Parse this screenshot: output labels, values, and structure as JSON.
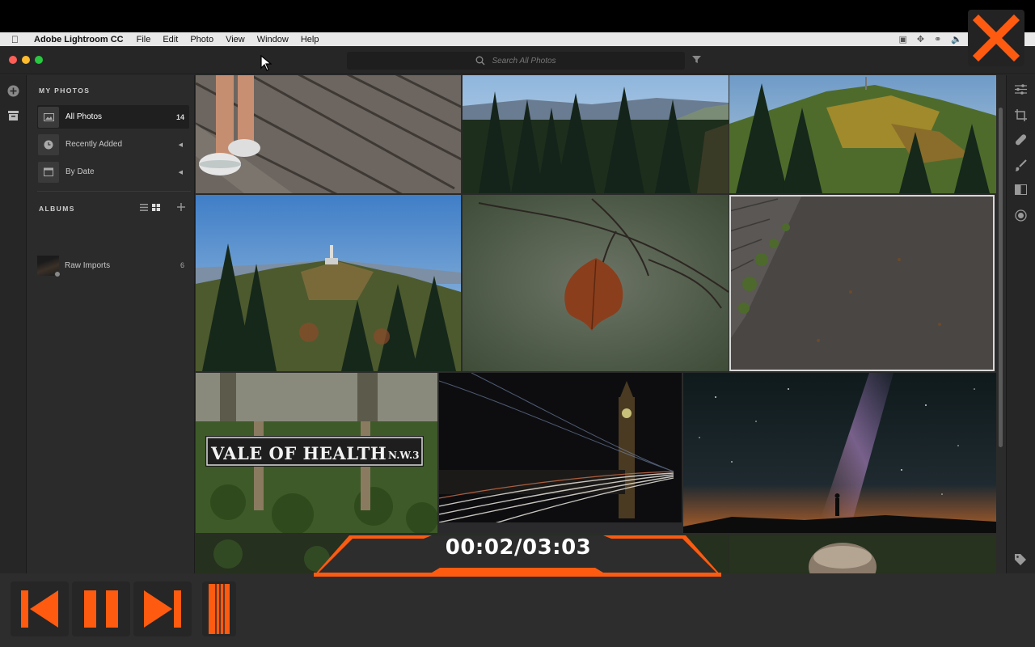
{
  "menubar": {
    "app_name": "Adobe Lightroom CC",
    "items": [
      "File",
      "Edit",
      "Photo",
      "View",
      "Window",
      "Help"
    ]
  },
  "search": {
    "placeholder": "Search All Photos"
  },
  "sidebar": {
    "my_photos_title": "MY PHOTOS",
    "nav": [
      {
        "label": "All Photos",
        "count": "14"
      },
      {
        "label": "Recently Added"
      },
      {
        "label": "By Date"
      }
    ],
    "albums_title": "ALBUMS",
    "albums": [
      {
        "label": "Raw Imports",
        "count": "6"
      }
    ]
  },
  "photos": [
    {
      "subject": "feet-on-boardwalk"
    },
    {
      "subject": "forest-ridge"
    },
    {
      "subject": "autumn-mountain"
    },
    {
      "subject": "mountain-tower"
    },
    {
      "subject": "autumn-leaf"
    },
    {
      "subject": "wet-ground",
      "selected": true
    },
    {
      "subject": "vale-of-health-sign",
      "sign_main": "VALE OF HEALTH",
      "sign_sub": "N.W.3"
    },
    {
      "subject": "big-ben-light-trails"
    },
    {
      "subject": "milky-way"
    }
  ],
  "player": {
    "timecode": "00:02/03:03"
  },
  "colors": {
    "accent": "#ff5b10",
    "panel": "#2b2b2b",
    "selection": "#d8d8d8"
  }
}
